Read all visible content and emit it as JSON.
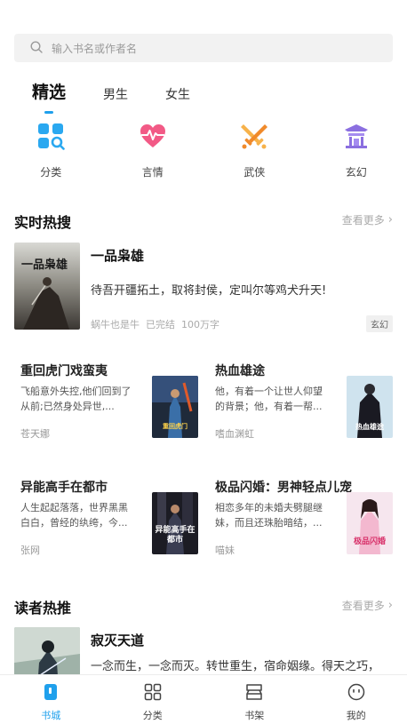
{
  "search": {
    "placeholder": "输入书名或作者名"
  },
  "tabs": [
    {
      "label": "精选",
      "active": true
    },
    {
      "label": "男生",
      "active": false
    },
    {
      "label": "女生",
      "active": false
    }
  ],
  "categories": [
    {
      "label": "分类",
      "icon": "category-grid-icon",
      "color": "#2aa8f0"
    },
    {
      "label": "言情",
      "icon": "heart-pulse-icon",
      "color": "#f25a86"
    },
    {
      "label": "武侠",
      "icon": "crossed-swords-icon",
      "color": "#f59a3a"
    },
    {
      "label": "玄幻",
      "icon": "temple-icon",
      "color": "#8b6fe0"
    }
  ],
  "hot_search": {
    "title": "实时热搜",
    "more": "查看更多",
    "featured": {
      "title": "一品枭雄",
      "cover_text": "一品枭雄",
      "desc": "待吾开疆拓土，取将封侯，定叫尔等鸡犬升天!",
      "author": "蜗牛也是牛",
      "status": "已完结",
      "words": "100万字",
      "tag": "玄幻"
    },
    "grid": [
      {
        "title": "重回虎门戏蛮夷",
        "desc": "飞船意外失控,他们回到了从前;已然身处异世,...",
        "author": "苍天娜",
        "cover_text": "重回虎门"
      },
      {
        "title": "热血雄途",
        "desc": "他，有着一个让世人仰望的背景；他，有着一帮...",
        "author": "嗜血渊虹",
        "cover_text": "热血雄途"
      },
      {
        "title": "异能高手在都市",
        "desc": "人生起起落落，世界黑黑白白，曾经的纨绔，今...",
        "author": "张网",
        "cover_text": "异能高手在都市"
      },
      {
        "title": "极品闪婚：男神轻点儿宠",
        "desc": "相恋多年的未婚夫劈腿继妹，而且还珠胎暗结，...",
        "author": "喵妹",
        "cover_text": "极品闪婚"
      }
    ]
  },
  "reader_recommend": {
    "title": "读者热推",
    "more": "查看更多",
    "featured": {
      "title": "寂灭天道",
      "desc": "一念而生，一念而灭。转世重生，宿命姻缘。得天之巧，"
    }
  },
  "bottom_nav": [
    {
      "label": "书城",
      "icon": "bookstore-icon",
      "active": true
    },
    {
      "label": "分类",
      "icon": "grid-icon",
      "active": false
    },
    {
      "label": "书架",
      "icon": "bookshelf-icon",
      "active": false
    },
    {
      "label": "我的",
      "icon": "profile-face-icon",
      "active": false
    }
  ],
  "colors": {
    "accent": "#1fa0ec",
    "text": "#222222",
    "muted": "#aaaaaa"
  }
}
